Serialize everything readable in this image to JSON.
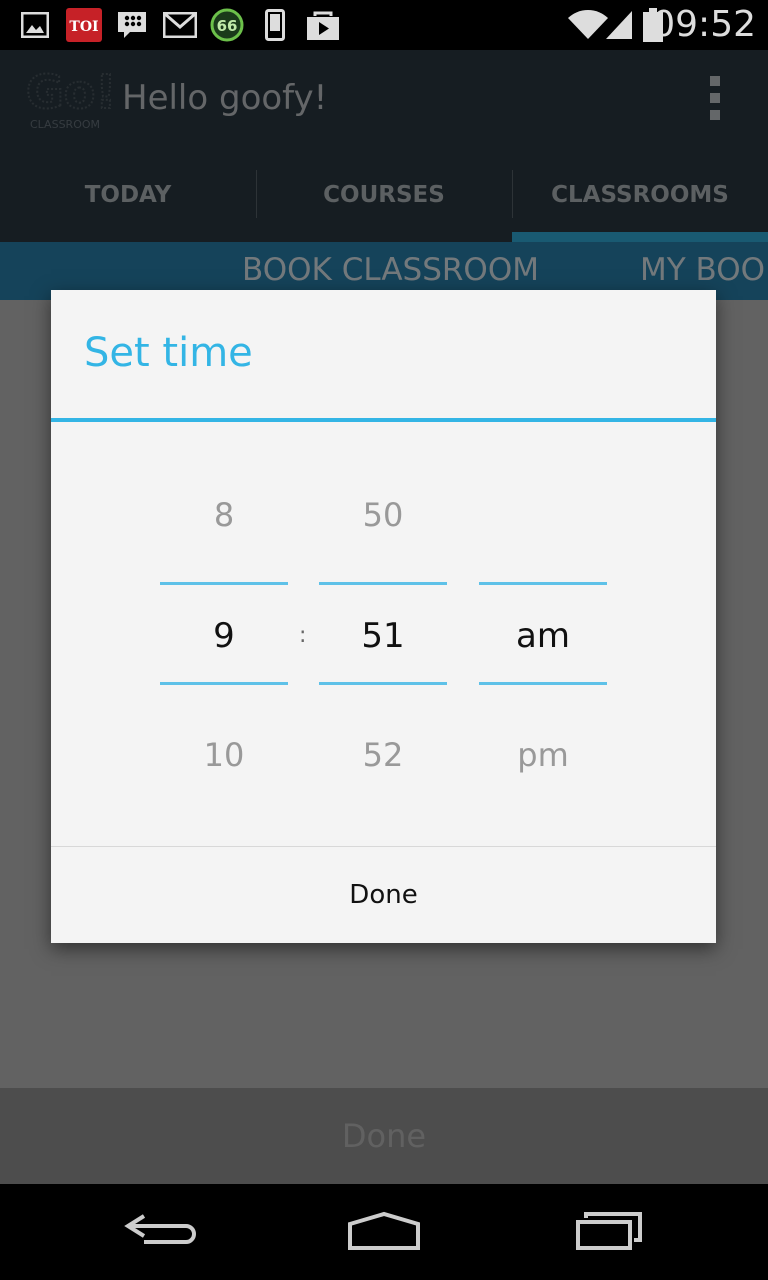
{
  "status_bar": {
    "time": "09:52",
    "notification_icons": [
      "gallery-icon",
      "toi-app-icon",
      "bbm-icon",
      "gmail-icon",
      "counter-66-icon",
      "phone-icon",
      "play-store-icon"
    ],
    "toi_label": "TOI",
    "counter_label": "66",
    "system_icons": [
      "wifi-icon",
      "signal-icon",
      "battery-icon"
    ]
  },
  "app_bar": {
    "logo_line1": "Go!",
    "logo_line2": "CLASSROOM",
    "title": "Hello goofy!",
    "overflow_icon": "overflow-menu-icon"
  },
  "tabs": [
    {
      "label": "TODAY",
      "active": false
    },
    {
      "label": "COURSES",
      "active": false
    },
    {
      "label": "CLASSROOMS",
      "active": true
    }
  ],
  "sub_tabs": [
    {
      "label": "BOOK CLASSROOM"
    },
    {
      "label": "MY BOOK"
    }
  ],
  "bottom_button": {
    "label": "Done"
  },
  "dialog": {
    "title": "Set time",
    "separator": ":",
    "hour": {
      "prev": "8",
      "selected": "9",
      "next": "10"
    },
    "minute": {
      "prev": "50",
      "selected": "51",
      "next": "52"
    },
    "ampm": {
      "prev": "",
      "selected": "am",
      "next": "pm"
    },
    "done_label": "Done"
  },
  "colors": {
    "accent": "#33b5e5",
    "app_bar": "#2d3b45",
    "sub_tab_bar": "#2a86b4"
  },
  "nav_bar": {
    "icons": [
      "back-icon",
      "home-icon",
      "recent-apps-icon"
    ]
  }
}
